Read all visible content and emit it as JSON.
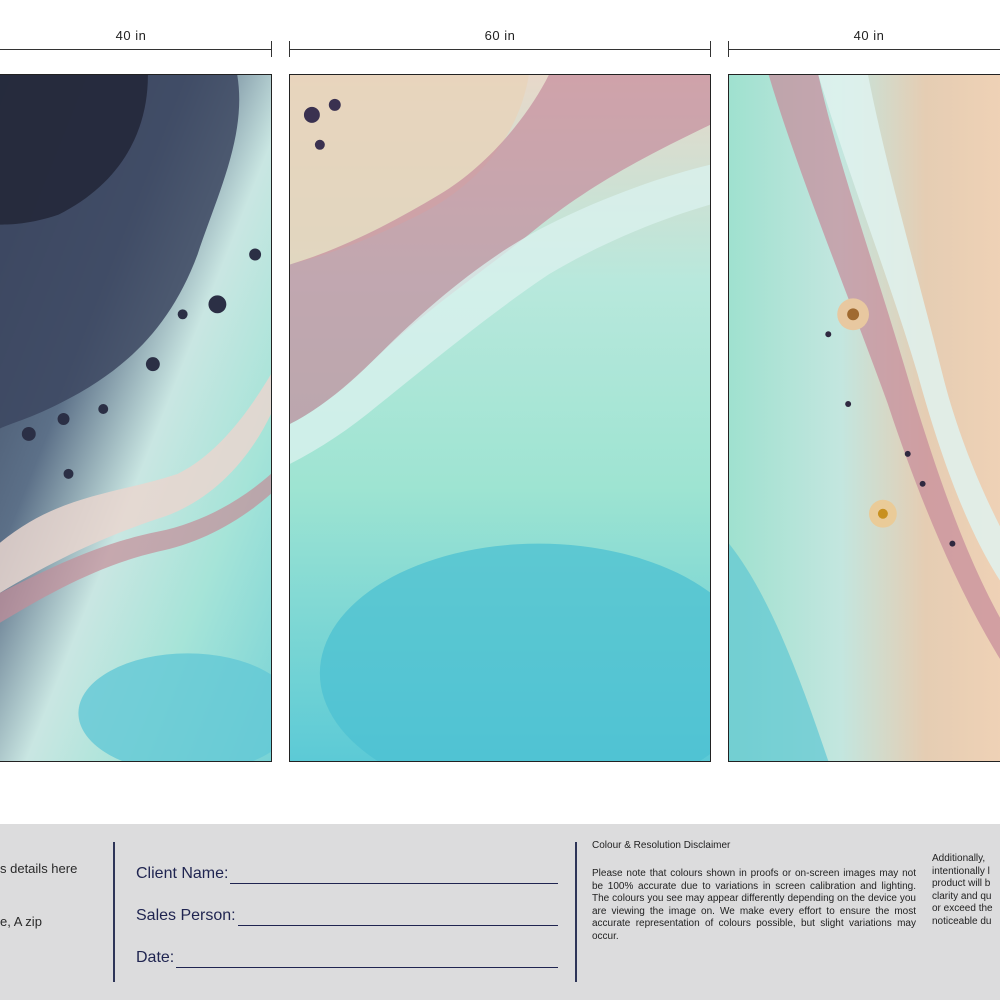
{
  "dimensions": {
    "left": "40 in",
    "center": "60 in",
    "right": "40 in"
  },
  "footer": {
    "address_line_1": "s details here",
    "address_line_2": "e, A zip",
    "client_name_label": "Client Name:",
    "sales_person_label": "Sales Person:",
    "date_label": "Date:",
    "disclaimer_title": "Colour & Resolution Disclaimer",
    "disclaimer_body": "Please note that colours shown in proofs or on-screen images may not be 100% accurate due to variations in screen calibration and lighting. The colours you see may appear differently depending on the device you are viewing the image on. We make every effort to ensure the most accurate representation of colours possible, but slight variations may occur.",
    "disclaimer_extra_lines": [
      "Additionally,",
      "intentionally l",
      "product will b",
      "clarity and qu",
      "or exceed the",
      "noticeable du"
    ]
  },
  "colors": {
    "footer_bg": "#dcdcdd",
    "divider": "#2e3558",
    "label_text": "#1f2450"
  }
}
